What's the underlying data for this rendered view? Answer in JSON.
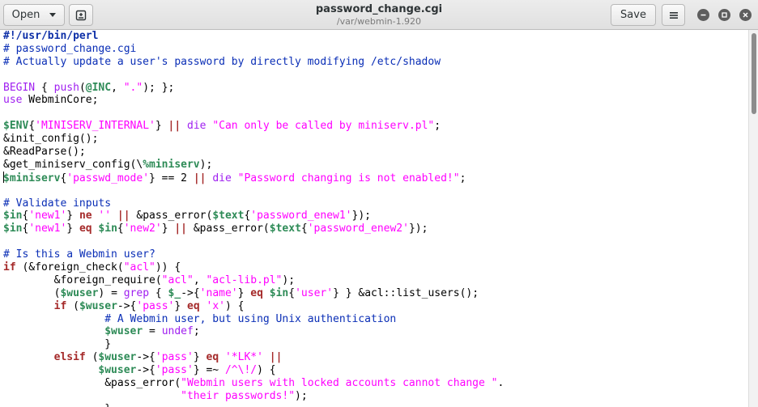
{
  "window": {
    "title": "password_change.cgi",
    "subtitle": "/var/webmin-1.920"
  },
  "toolbar": {
    "open_label": "Open",
    "save_label": "Save",
    "new_tab_icon": "new-document-icon",
    "menu_icon": "hamburger-menu-icon"
  },
  "window_controls": [
    "minimize",
    "maximize",
    "close"
  ],
  "colors": {
    "comment": "#0a2eb6",
    "keyword": "#a52a2a",
    "builtin": "#a020f0",
    "variable": "#2e8b57",
    "string": "#ff00ff"
  },
  "code_lines": [
    [
      [
        "shebang",
        "#!/usr/bin/perl"
      ]
    ],
    [
      [
        "comment",
        "# password_change.cgi"
      ]
    ],
    [
      [
        "comment",
        "# Actually update a user's password by directly modifying /etc/shadow"
      ]
    ],
    [],
    [
      [
        "builtin",
        "BEGIN"
      ],
      [
        "plain",
        " { "
      ],
      [
        "builtin",
        "push"
      ],
      [
        "plain",
        "("
      ],
      [
        "var",
        "@INC"
      ],
      [
        "plain",
        ", "
      ],
      [
        "str",
        "\".\""
      ],
      [
        "plain",
        "); };"
      ]
    ],
    [
      [
        "builtin",
        "use"
      ],
      [
        "plain",
        " WebminCore;"
      ]
    ],
    [],
    [
      [
        "var",
        "$ENV"
      ],
      [
        "plain",
        "{"
      ],
      [
        "str",
        "'MINISERV_INTERNAL'"
      ],
      [
        "plain",
        "} "
      ],
      [
        "op",
        "||"
      ],
      [
        "plain",
        " "
      ],
      [
        "builtin",
        "die"
      ],
      [
        "plain",
        " "
      ],
      [
        "str",
        "\"Can only be called by miniserv.pl\""
      ],
      [
        "plain",
        ";"
      ]
    ],
    [
      [
        "plain",
        "&init_config();"
      ]
    ],
    [
      [
        "plain",
        "&ReadParse();"
      ]
    ],
    [
      [
        "plain",
        "&get_miniserv_config(\\"
      ],
      [
        "var",
        "%miniserv"
      ],
      [
        "plain",
        ");"
      ]
    ],
    [
      [
        "var",
        "$miniserv"
      ],
      [
        "plain",
        "{"
      ],
      [
        "str",
        "'passwd_mode'"
      ],
      [
        "plain",
        "} == 2 "
      ],
      [
        "op",
        "||"
      ],
      [
        "plain",
        " "
      ],
      [
        "builtin",
        "die"
      ],
      [
        "plain",
        " "
      ],
      [
        "str",
        "\"Password changing is not enabled!\""
      ],
      [
        "plain",
        ";"
      ]
    ],
    [],
    [
      [
        "comment",
        "# Validate inputs"
      ]
    ],
    [
      [
        "var",
        "$in"
      ],
      [
        "plain",
        "{"
      ],
      [
        "str",
        "'new1'"
      ],
      [
        "plain",
        "} "
      ],
      [
        "kw",
        "ne"
      ],
      [
        "plain",
        " "
      ],
      [
        "str",
        "''"
      ],
      [
        "plain",
        " "
      ],
      [
        "op",
        "||"
      ],
      [
        "plain",
        " &pass_error("
      ],
      [
        "var",
        "$text"
      ],
      [
        "plain",
        "{"
      ],
      [
        "str",
        "'password_enew1'"
      ],
      [
        "plain",
        "});"
      ]
    ],
    [
      [
        "var",
        "$in"
      ],
      [
        "plain",
        "{"
      ],
      [
        "str",
        "'new1'"
      ],
      [
        "plain",
        "} "
      ],
      [
        "kw",
        "eq"
      ],
      [
        "plain",
        " "
      ],
      [
        "var",
        "$in"
      ],
      [
        "plain",
        "{"
      ],
      [
        "str",
        "'new2'"
      ],
      [
        "plain",
        "} "
      ],
      [
        "op",
        "||"
      ],
      [
        "plain",
        " &pass_error("
      ],
      [
        "var",
        "$text"
      ],
      [
        "plain",
        "{"
      ],
      [
        "str",
        "'password_enew2'"
      ],
      [
        "plain",
        "});"
      ]
    ],
    [],
    [
      [
        "comment",
        "# Is this a Webmin user?"
      ]
    ],
    [
      [
        "kw",
        "if"
      ],
      [
        "plain",
        " (&foreign_check("
      ],
      [
        "str",
        "\"acl\""
      ],
      [
        "plain",
        ")) {"
      ]
    ],
    [
      [
        "plain",
        "        &foreign_require("
      ],
      [
        "str",
        "\"acl\""
      ],
      [
        "plain",
        ", "
      ],
      [
        "str",
        "\"acl-lib.pl\""
      ],
      [
        "plain",
        ");"
      ]
    ],
    [
      [
        "plain",
        "        ("
      ],
      [
        "var",
        "$wuser"
      ],
      [
        "plain",
        ") = "
      ],
      [
        "builtin",
        "grep"
      ],
      [
        "plain",
        " { "
      ],
      [
        "var",
        "$_"
      ],
      [
        "plain",
        "->{"
      ],
      [
        "str",
        "'name'"
      ],
      [
        "plain",
        "} "
      ],
      [
        "kw",
        "eq"
      ],
      [
        "plain",
        " "
      ],
      [
        "var",
        "$in"
      ],
      [
        "plain",
        "{"
      ],
      [
        "str",
        "'user'"
      ],
      [
        "plain",
        "} } &acl::list_users();"
      ]
    ],
    [
      [
        "plain",
        "        "
      ],
      [
        "kw",
        "if"
      ],
      [
        "plain",
        " ("
      ],
      [
        "var",
        "$wuser"
      ],
      [
        "plain",
        "->{"
      ],
      [
        "str",
        "'pass'"
      ],
      [
        "plain",
        "} "
      ],
      [
        "kw",
        "eq"
      ],
      [
        "plain",
        " "
      ],
      [
        "str",
        "'x'"
      ],
      [
        "plain",
        ") {"
      ]
    ],
    [
      [
        "plain",
        "                "
      ],
      [
        "comment",
        "# A Webmin user, but using Unix authentication"
      ]
    ],
    [
      [
        "plain",
        "                "
      ],
      [
        "var",
        "$wuser"
      ],
      [
        "plain",
        " = "
      ],
      [
        "builtin",
        "undef"
      ],
      [
        "plain",
        ";"
      ]
    ],
    [
      [
        "plain",
        "                }"
      ]
    ],
    [
      [
        "plain",
        "        "
      ],
      [
        "kw",
        "elsif"
      ],
      [
        "plain",
        " ("
      ],
      [
        "var",
        "$wuser"
      ],
      [
        "plain",
        "->{"
      ],
      [
        "str",
        "'pass'"
      ],
      [
        "plain",
        "} "
      ],
      [
        "kw",
        "eq"
      ],
      [
        "plain",
        " "
      ],
      [
        "str",
        "'*LK*'"
      ],
      [
        "plain",
        " "
      ],
      [
        "op",
        "||"
      ]
    ],
    [
      [
        "plain",
        "               "
      ],
      [
        "var",
        "$wuser"
      ],
      [
        "plain",
        "->{"
      ],
      [
        "str",
        "'pass'"
      ],
      [
        "plain",
        "} =~ "
      ],
      [
        "str",
        "/^\\!/"
      ],
      [
        "plain",
        ") {"
      ]
    ],
    [
      [
        "plain",
        "                &pass_error("
      ],
      [
        "str",
        "\"Webmin users with locked accounts cannot change \""
      ],
      [
        "plain",
        "."
      ]
    ],
    [
      [
        "plain",
        "                            "
      ],
      [
        "str",
        "\"their passwords!\""
      ],
      [
        "plain",
        ");"
      ]
    ],
    [
      [
        "plain",
        "                }"
      ]
    ]
  ]
}
